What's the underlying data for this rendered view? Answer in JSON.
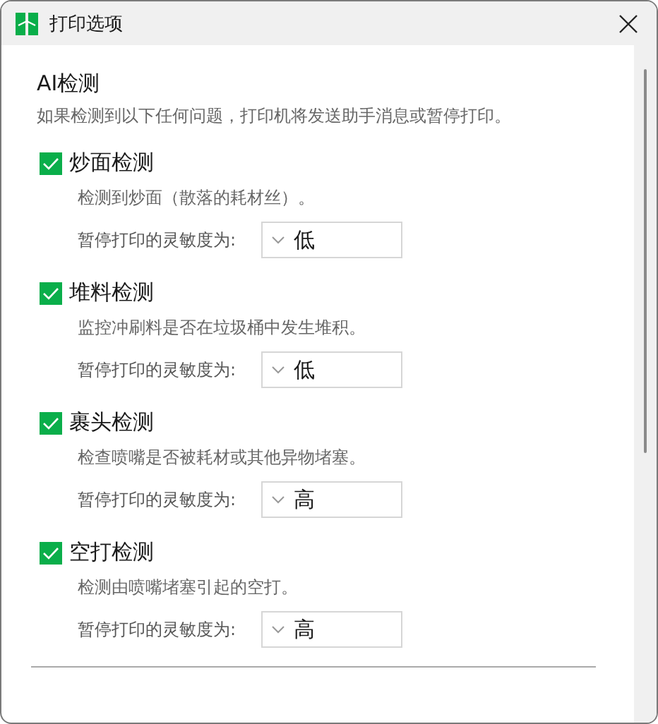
{
  "window": {
    "title": "打印选项"
  },
  "section": {
    "title": "AI检测",
    "description": "如果检测到以下任何问题，打印机将发送助手消息或暂停打印。"
  },
  "detections": [
    {
      "title": "炒面检测",
      "checked": true,
      "description": "检测到炒面（散落的耗材丝）。",
      "sensitivity_label": "暂停打印的灵敏度为:",
      "sensitivity": "低"
    },
    {
      "title": "堆料检测",
      "checked": true,
      "description": "监控冲刷料是否在垃圾桶中发生堆积。",
      "sensitivity_label": "暂停打印的灵敏度为:",
      "sensitivity": "低"
    },
    {
      "title": "裹头检测",
      "checked": true,
      "description": "检查喷嘴是否被耗材或其他异物堵塞。",
      "sensitivity_label": "暂停打印的灵敏度为:",
      "sensitivity": "高"
    },
    {
      "title": "空打检测",
      "checked": true,
      "description": "检测由喷嘴堵塞引起的空打。",
      "sensitivity_label": "暂停打印的灵敏度为:",
      "sensitivity": "高"
    }
  ]
}
